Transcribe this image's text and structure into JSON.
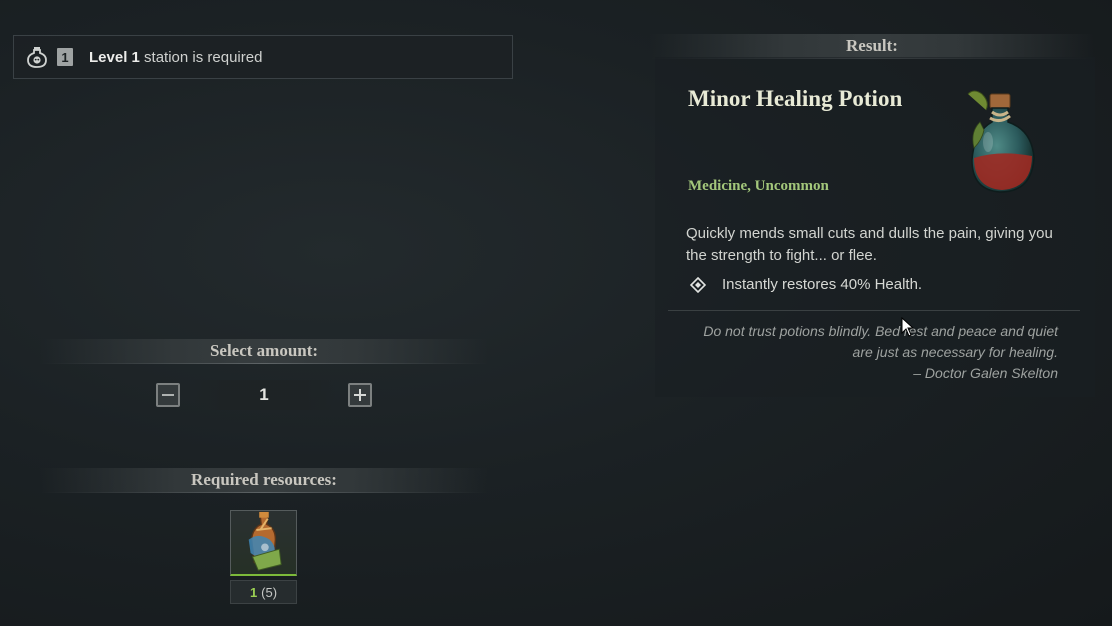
{
  "station": {
    "level_badge": "1",
    "level_word": "Level 1",
    "requirement_suffix": " station is required",
    "icon": "potion-skull-icon"
  },
  "amount": {
    "header": "Select amount:",
    "value": "1",
    "decrease_icon": "minus-icon",
    "increase_icon": "plus-icon"
  },
  "resources": {
    "header": "Required resources:",
    "items": [
      {
        "icon": "herb-bottle-icon",
        "have": "1",
        "need": "(5)"
      }
    ]
  },
  "result": {
    "header": "Result:",
    "name": "Minor Healing Potion",
    "category": "Medicine, Uncommon",
    "description": "Quickly mends small cuts and dulls the pain, giving you the strength to fight... or flee.",
    "effect": "Instantly restores 40% Health.",
    "effect_icon": "diamond-bullet-icon",
    "quote_lines": [
      "Do not trust potions blindly. Bed rest and peace and quiet",
      "are just as necessary for healing.",
      "– Doctor Galen Skelton"
    ],
    "image_icon": "red-potion-flask-icon"
  },
  "colors": {
    "category_green": "#a3c77b",
    "resource_have_green": "#9bd053",
    "title_cream": "#e8ead6"
  }
}
